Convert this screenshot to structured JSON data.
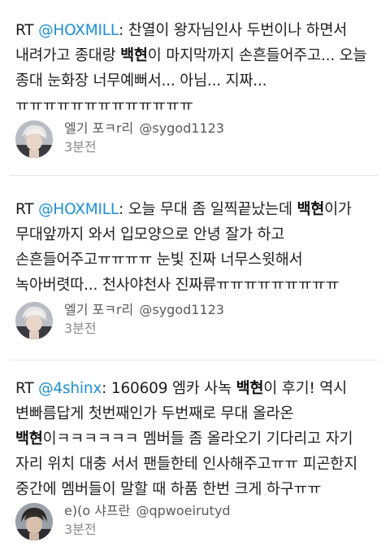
{
  "tweets": [
    {
      "segments": [
        {
          "t": "RT "
        },
        {
          "t": "@HOXMILL",
          "c": "mention"
        },
        {
          "t": ": 찬열이 왕자님인사 두번이나 하면서 내려가고 종대랑 "
        },
        {
          "t": "백현",
          "c": "hl"
        },
        {
          "t": "이 마지막까지 손흔들어주고... 오늘 종대 눈화장 너무예뻐서... 아님... 지짜...ㅠㅠㅠㅠㅠㅠㅠㅠㅠㅠㅠㅠㅠ"
        }
      ],
      "author_name": "엘기 포ㅋr리",
      "author_handle": "@sygod1123",
      "time": "3분전"
    },
    {
      "segments": [
        {
          "t": "RT "
        },
        {
          "t": "@HOXMILL",
          "c": "mention"
        },
        {
          "t": ": 오늘 무대 좀 일찍끝났는데 "
        },
        {
          "t": "백현",
          "c": "hl"
        },
        {
          "t": "이가 무대앞까지 와서 입모양으로 안녕 잘가 하고 손흔들어주고ㅠㅠㅠㅠ 눈빛 진짜 너무스윗해서 녹아버렷따... 천사야천사 진짜류ㅠㅠㅠㅠㅠㅠㅠㅠㅠ"
        }
      ],
      "author_name": "엘기 포ㅋr리",
      "author_handle": "@sygod1123",
      "time": "3분전"
    },
    {
      "segments": [
        {
          "t": "RT "
        },
        {
          "t": "@4shinx",
          "c": "mention"
        },
        {
          "t": ": 160609 엠카 사녹 "
        },
        {
          "t": "백현",
          "c": "hl"
        },
        {
          "t": "이 후기! 역시 변빠름답게 첫번째인가 두번째로 무대 올라온 "
        },
        {
          "t": "백현",
          "c": "hl"
        },
        {
          "t": "이ㅋㅋㅋㅋㅋㅋ 멤버들 좀 올라오기 기다리고 자기 자리 위치 대충 서서 팬들한테 인사해주고ㅠㅠ 피곤한지 중간에 멤버들이 말할 때 하품 한번 크게 하구ㅠㅠ"
        }
      ],
      "author_name": "e)(o 샤프란",
      "author_handle": "@qpwoeirutyd",
      "time": "3분전"
    }
  ]
}
